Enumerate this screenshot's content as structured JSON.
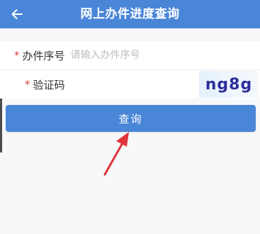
{
  "header": {
    "title": "网上办件进度查询",
    "back_icon": "arrow-left-icon"
  },
  "form": {
    "case_number": {
      "required_mark": "*",
      "label": "办件序号",
      "placeholder": "请输入办件序号",
      "value": ""
    },
    "captcha": {
      "required_mark": "*",
      "label": "验证码",
      "value": "",
      "code": "ng8g"
    }
  },
  "actions": {
    "query_label": "查询"
  },
  "colors": {
    "primary": "#4a86d8",
    "required": "#d9453b",
    "annotation_arrow": "#e0353b"
  }
}
